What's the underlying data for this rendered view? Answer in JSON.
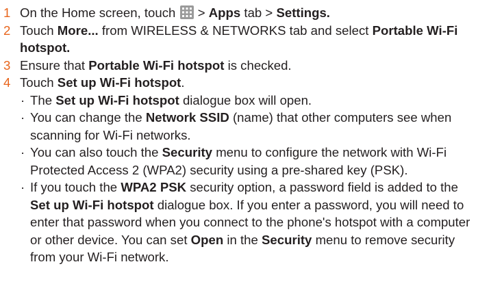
{
  "steps": [
    {
      "number": "1",
      "parts": [
        "On the Home screen, touch",
        "> ",
        "Apps",
        " tab > ",
        "Settings."
      ],
      "icon": "apps-grid-icon"
    },
    {
      "number": "2",
      "parts": [
        "Touch ",
        "More...",
        " from WIRELESS & NETWORKS tab and select ",
        "Portable Wi-Fi hotspot."
      ]
    },
    {
      "number": "3",
      "parts": [
        "Ensure that ",
        "Portable Wi-Fi hotspot",
        " is checked."
      ]
    },
    {
      "number": "4",
      "parts": [
        "Touch ",
        "Set up Wi-Fi hotspot",
        "."
      ]
    }
  ],
  "bullets": [
    {
      "parts": [
        "The ",
        "Set up Wi-Fi hotspot",
        " dialogue box will open."
      ]
    },
    {
      "parts": [
        "You can change the ",
        "Network SSID",
        " (name) that other computers see when scanning for Wi-Fi networks."
      ]
    },
    {
      "parts": [
        "You can also touch the ",
        "Security",
        " menu to configure the network with Wi-Fi Protected Access 2 (WPA2) security using a pre-shared key (PSK)."
      ]
    },
    {
      "parts": [
        "If you touch the ",
        "WPA2 PSK",
        " security option, a password field is added to the ",
        "Set up Wi-Fi hotspot",
        " dialogue box. If you enter a password, you will need to enter that password when you connect to the phone's hotspot with a computer or other device. You can set ",
        "Open",
        " in the ",
        "Security",
        " menu to remove security from your Wi-Fi network."
      ]
    }
  ],
  "bullet_glyph": "·",
  "colors": {
    "step_number": "#e8651c",
    "text": "#231f20",
    "icon_bg": "#9a9a9a"
  }
}
